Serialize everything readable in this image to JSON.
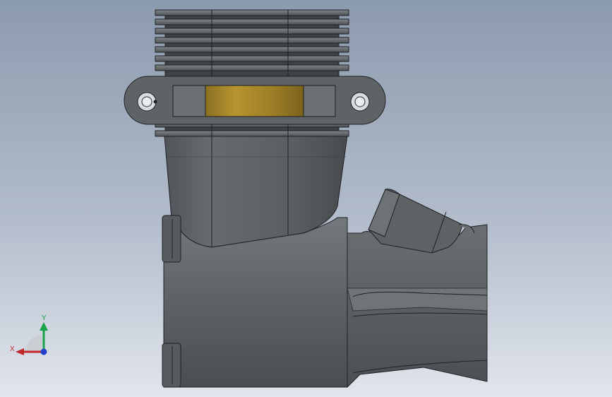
{
  "viewport": {
    "background_top": "#8c9aae",
    "background_bottom": "#e1e5ec",
    "model_color": "#5b5f61",
    "insert_color": "#a8862c",
    "edge_color": "#1f2224"
  },
  "triad": {
    "x_label": "X",
    "y_label": "Y",
    "x_color": "#c0282b",
    "y_color": "#1aa14a",
    "z_color": "#2540c8"
  }
}
